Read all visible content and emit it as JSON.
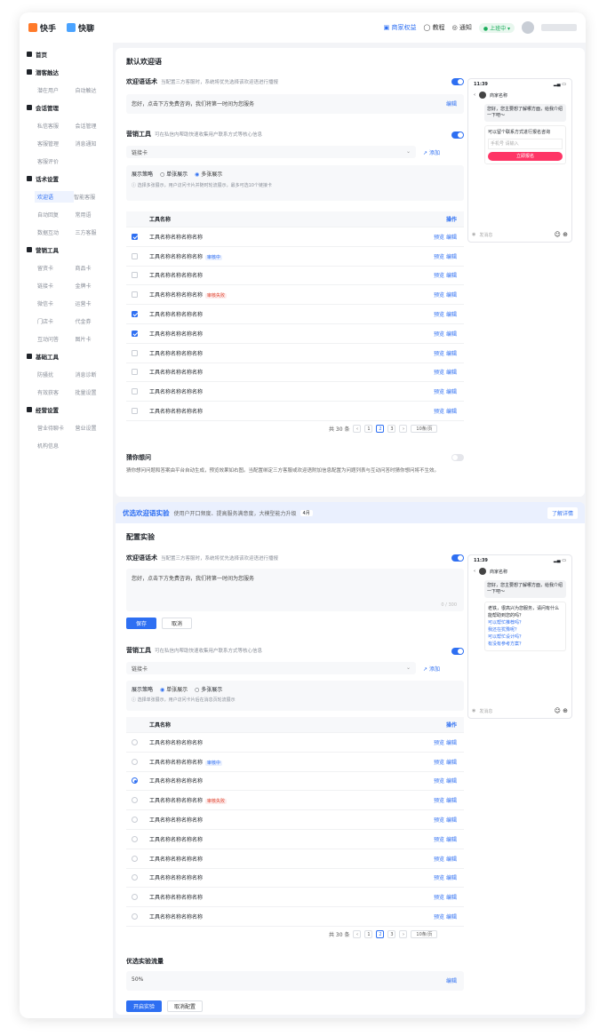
{
  "topbar": {
    "brand1": "快手",
    "brand2": "快聊",
    "merchant": "商家权益",
    "tutorial": "教程",
    "notice": "通知",
    "status": "上班中"
  },
  "sidebar": [
    {
      "title": "首页",
      "items": []
    },
    {
      "title": "潜客触达",
      "items": [
        "潜在用户",
        "自动触达"
      ]
    },
    {
      "title": "会话管理",
      "items": [
        "私信客服",
        "会话管理",
        "客服管理",
        "消息通知",
        "客服评价"
      ]
    },
    {
      "title": "话术设置",
      "items": [
        "欢迎语",
        "智能客服",
        "自动回复",
        "常用语",
        "数据互动",
        "三方客服"
      ]
    },
    {
      "title": "营销工具",
      "items": [
        "留资卡",
        "商品卡",
        "链接卡",
        "金牌卡",
        "微信卡",
        "运营卡",
        "门店卡",
        "代金券",
        "互动问答",
        "图片卡"
      ]
    },
    {
      "title": "基础工具",
      "items": [
        "防骚扰",
        "消息诊断",
        "有效获客",
        "批量设置"
      ]
    },
    {
      "title": "经营设置",
      "items": [
        "营业待聊卡",
        "营业设置",
        "机构信息"
      ]
    }
  ],
  "section1": {
    "title": "默认欢迎语",
    "welcome_label": "欢迎语话术",
    "welcome_hint": "当配置三方客服时，系统将优先选择该欢迎语进行播报",
    "welcome_text": "您好，点击下方免费咨询，我们将第一时间为您服务",
    "edit": "编辑",
    "tool_label": "营销工具",
    "tool_hint": "可在私信内帮助快速收集用户联系方式等核心信息",
    "select": "链接卡",
    "add": "添加",
    "strategy_label": "展示策略",
    "opt_single": "单张展示",
    "opt_multi": "多张展示",
    "strategy_hint": "选择多张展示，用户访问卡片并随时轮流展示，最多可选10个链接卡",
    "col_name": "工具名称",
    "col_ops": "操作",
    "rows": [
      {
        "name": "工具名称名称名称名称",
        "tag": "",
        "checked": true
      },
      {
        "name": "工具名称名称名称名称",
        "tag": "审核中",
        "tagc": "b",
        "checked": false
      },
      {
        "name": "工具名称名称名称名称",
        "tag": "",
        "checked": false
      },
      {
        "name": "工具名称名称名称名称",
        "tag": "审核失败",
        "tagc": "r",
        "checked": false
      },
      {
        "name": "工具名称名称名称名称",
        "tag": "",
        "checked": true
      },
      {
        "name": "工具名称名称名称名称",
        "tag": "",
        "checked": true
      },
      {
        "name": "工具名称名称名称名称",
        "tag": "",
        "checked": false
      },
      {
        "name": "工具名称名称名称名称",
        "tag": "",
        "checked": false
      },
      {
        "name": "工具名称名称名称名称",
        "tag": "",
        "checked": false
      },
      {
        "name": "工具名称名称名称名称",
        "tag": "",
        "checked": false
      }
    ],
    "op_preview": "预览",
    "op_edit": "编辑",
    "pager": {
      "total": "共 30 条",
      "pages": [
        "1",
        "2",
        "3"
      ],
      "current": "2",
      "size": "10条/页"
    },
    "guess_label": "猜你想问",
    "guess_text": "猜你想问问题和答案由平台自动生成，预览效果如右图。当配置绑定三方客服或欢迎语附加信息配置为问题列表与互动问答时猜你想问将不生效。",
    "phone": {
      "time": "11:39",
      "name": "商家名称",
      "msg": "您好，您主要想了解哪方面，给我介绍一下吧～",
      "card_title": "可以留个联系方式进行报名咨询",
      "fields": [
        "手机号",
        "请输入"
      ],
      "btn": "立即报名",
      "input": "发消息"
    }
  },
  "banner": {
    "title": "优选欢迎语实验",
    "desc": "使用户开口频度、提高服务满意度，大模型能力升级",
    "badge": "4月",
    "link": "了解详情"
  },
  "section2": {
    "title": "配置实验",
    "welcome_label": "欢迎语话术",
    "welcome_hint": "当配置三方客服时，系统将优先选择该欢迎语进行播报",
    "welcome_text": "您好，点击下方免费咨询，我们将第一时间为您服务",
    "counter": "0 / 300",
    "save": "保存",
    "cancel": "取消",
    "tool_label": "营销工具",
    "tool_hint": "可在私信内帮助快速收集用户联系方式等核心信息",
    "select": "链接卡",
    "add": "添加",
    "strategy_label": "展示策略",
    "opt_single": "单张展示",
    "opt_multi": "多张展示",
    "strategy_hint": "选择单张展示，用户访问卡片后在消息页轮流展示",
    "rows": [
      {
        "name": "工具名称名称名称名称",
        "tag": "",
        "checked": false
      },
      {
        "name": "工具名称名称名称名称",
        "tag": "审核中",
        "tagc": "b",
        "checked": false
      },
      {
        "name": "工具名称名称名称名称",
        "tag": "",
        "checked": true
      },
      {
        "name": "工具名称名称名称名称",
        "tag": "审核失败",
        "tagc": "r",
        "checked": false
      },
      {
        "name": "工具名称名称名称名称",
        "tag": "",
        "checked": false
      },
      {
        "name": "工具名称名称名称名称",
        "tag": "",
        "checked": false
      },
      {
        "name": "工具名称名称名称名称",
        "tag": "",
        "checked": false
      },
      {
        "name": "工具名称名称名称名称",
        "tag": "",
        "checked": false
      },
      {
        "name": "工具名称名称名称名称",
        "tag": "",
        "checked": false
      },
      {
        "name": "工具名称名称名称名称",
        "tag": "",
        "checked": false
      }
    ],
    "traffic_label": "优选实验流量",
    "traffic_value": "50%",
    "start": "开启实验",
    "cancel_cfg": "取消配置",
    "phone": {
      "time": "11:39",
      "name": "商家名称",
      "msg": "您好，您主要想了解哪方面，给我介绍一下吧～",
      "q_title": "老铁，很高兴为您服务，请问有什么能帮助到您的吗？",
      "questions": [
        "可以帮忙推荐吗？",
        "我还在犹豫呢？",
        "可以帮忙设计吗？",
        "有没有参考方案？"
      ],
      "input": "发消息"
    }
  }
}
